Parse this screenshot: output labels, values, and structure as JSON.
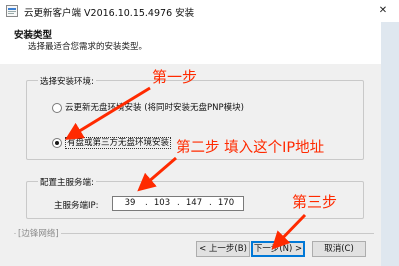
{
  "window": {
    "title": "云更新客户端 V2016.10.15.4976 安装",
    "close_glyph": "✕"
  },
  "header": {
    "title": "安装类型",
    "subtitle": "选择最适合您需求的安装类型。"
  },
  "env_group": {
    "title": "选择安装环境:",
    "options": [
      {
        "label": "云更新无盘环境安装 (将同时安装无盘PNP模块)",
        "checked": false
      },
      {
        "label": "有盘或第三方无盘环境安装",
        "checked": true
      }
    ]
  },
  "server_group": {
    "title": "配置主服务端:",
    "ip_label": "主服务端IP:",
    "ip": [
      "39",
      "103",
      "147",
      "170"
    ],
    "ip_separator": "."
  },
  "brand": "[边锋网络]",
  "buttons": {
    "back": "< 上一步(B)",
    "next": "下一步(N) >",
    "cancel": "取消(C)"
  },
  "annotations": {
    "step1": "第一步",
    "step2": "第二步  填入这个IP地址",
    "step3": "第三步",
    "color": "#ff2a00"
  }
}
